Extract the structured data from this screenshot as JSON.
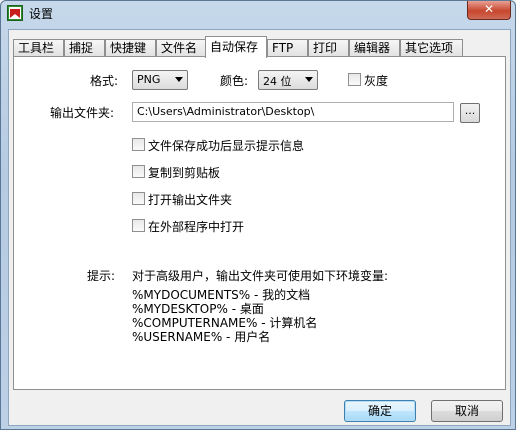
{
  "window": {
    "title": "设置",
    "close_glyph": "✕"
  },
  "tabs": [
    "工具栏",
    "捕捉",
    "快捷键",
    "文件名",
    "自动保存",
    "FTP",
    "打印",
    "编辑器",
    "其它选项"
  ],
  "active_tab_index": 4,
  "format": {
    "label": "格式:",
    "value": "PNG"
  },
  "color": {
    "label": "颜色:",
    "value": "24 位"
  },
  "grayscale": {
    "label": "灰度",
    "checked": false
  },
  "output": {
    "label": "输出文件夹:",
    "value": "C:\\Users\\Administrator\\Desktop\\",
    "browse_label": "..."
  },
  "options": [
    {
      "label": "文件保存成功后显示提示信息",
      "checked": false
    },
    {
      "label": "复制到剪贴板",
      "checked": false
    },
    {
      "label": "打开输出文件夹",
      "checked": false
    },
    {
      "label": "在外部程序中打开",
      "checked": false
    }
  ],
  "hint": {
    "label": "提示:",
    "intro": "对于高级用户，输出文件夹可使用如下环境变量:",
    "vars": [
      "%MYDOCUMENTS% - 我的文档",
      "%MYDESKTOP% - 桌面",
      "%COMPUTERNAME% - 计算机名",
      "%USERNAME% - 用户名"
    ]
  },
  "buttons": {
    "ok": "确定",
    "cancel": "取消"
  }
}
